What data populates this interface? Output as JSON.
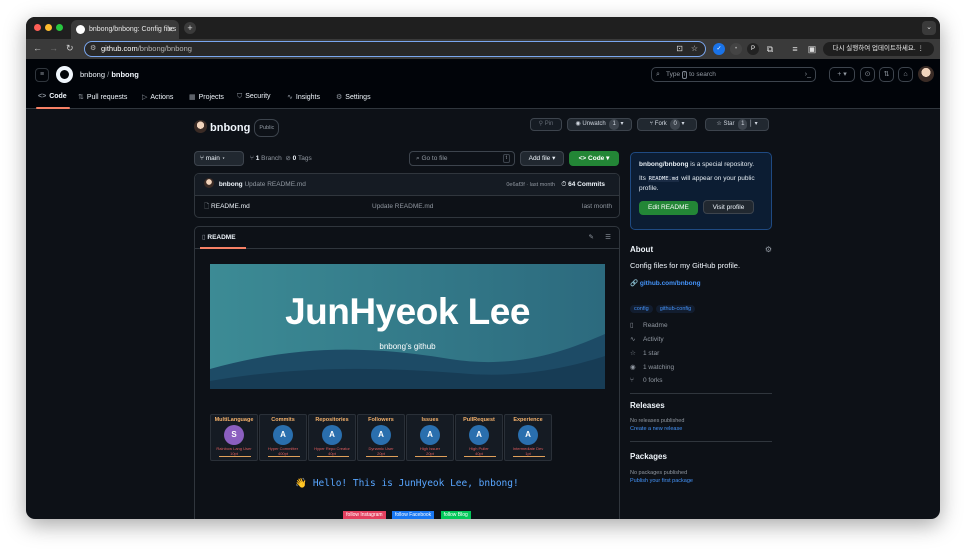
{
  "browser": {
    "tab_title": "bnbong/bnbong: Config files",
    "url_host": "github.com",
    "url_path": "/bnbong/bnbong",
    "update_label": "다시 실행하여 업데이트하세요."
  },
  "header": {
    "owner": "bnbong",
    "separator": "/",
    "repo": "bnbong",
    "search_placeholder_pre": "Type",
    "search_slash": "/",
    "search_placeholder_post": "to search"
  },
  "repo_nav": {
    "tabs": [
      {
        "label": "Code",
        "icon": "<>"
      },
      {
        "label": "Pull requests",
        "icon": "⇅"
      },
      {
        "label": "Actions",
        "icon": "▷"
      },
      {
        "label": "Projects",
        "icon": "▦"
      },
      {
        "label": "Security",
        "icon": "⛉"
      },
      {
        "label": "Insights",
        "icon": "∿"
      },
      {
        "label": "Settings",
        "icon": "⚙"
      }
    ]
  },
  "repo": {
    "name": "bnbong",
    "visibility": "Public",
    "pin_label": "Pin",
    "unwatch_label": "Unwatch",
    "watch_count": "1",
    "fork_label": "Fork",
    "fork_count": "0",
    "star_label": "Star",
    "star_count": "1"
  },
  "toolbar": {
    "branch": "main",
    "branch_count": "1",
    "branch_label": "Branch",
    "tag_count": "0",
    "tag_label": "Tags",
    "goto_placeholder": "Go to file",
    "goto_key": "t",
    "add_file_label": "Add file",
    "code_label": "Code"
  },
  "commit": {
    "author": "bnbong",
    "message": "Update README.md",
    "hash_time": "0e6af3f · last month",
    "commits_count": "64 Commits"
  },
  "files": [
    {
      "name": "README.md",
      "message": "Update README.md",
      "when": "last month"
    }
  ],
  "readme": {
    "tab_label": "README",
    "banner_title": "JunHyeok Lee",
    "banner_subtitle": "bnbong's github",
    "hello": "👋 Hello! This is JunHyeok Lee, bnbong!",
    "trophies": [
      {
        "title": "MultiLanguage",
        "letter": "S",
        "label": "Rainbow Lang User",
        "points": "10pt"
      },
      {
        "title": "Commits",
        "letter": "A",
        "label": "Hyper Committer",
        "points": "400pt"
      },
      {
        "title": "Repositories",
        "letter": "A",
        "label": "Hyper Repo Creator",
        "points": "40pt"
      },
      {
        "title": "Followers",
        "letter": "A",
        "label": "Dynamic User",
        "points": "20pt"
      },
      {
        "title": "Issues",
        "letter": "A",
        "label": "High Issuer",
        "points": "20pt"
      },
      {
        "title": "PullRequest",
        "letter": "A",
        "label": "High Puller",
        "points": "40pt"
      },
      {
        "title": "Experience",
        "letter": "A",
        "label": "Intermediate Dev",
        "points": "1pt"
      }
    ],
    "badges": [
      {
        "label": "follow Instagram",
        "color": "#e4405f"
      },
      {
        "label": "follow Facebook",
        "color": "#1877f2"
      },
      {
        "label": "follow Blog",
        "color": "#03c75a"
      }
    ]
  },
  "sidebar": {
    "special_repo": "bnbong/bnbong",
    "special_text": " is a special repository.",
    "special_line2_pre": "Its ",
    "special_code": "README.md",
    "special_line2_post": " will appear on your public profile.",
    "edit_readme": "Edit README",
    "visit_profile": "Visit profile",
    "about_title": "About",
    "description": "Config files for my GitHub profile.",
    "website": "github.com/bnbong",
    "topics": [
      "config",
      "github-config"
    ],
    "meta": [
      {
        "icon": "📖",
        "label": "Readme"
      },
      {
        "icon": "∿",
        "label": "Activity"
      },
      {
        "icon": "☆",
        "label": "1 star"
      },
      {
        "icon": "◉",
        "label": "1 watching"
      },
      {
        "icon": "⑂",
        "label": "0 forks"
      }
    ],
    "releases_title": "Releases",
    "releases_text": "No releases published",
    "releases_link": "Create a new release",
    "packages_title": "Packages",
    "packages_text": "No packages published",
    "packages_link": "Publish your first package"
  }
}
